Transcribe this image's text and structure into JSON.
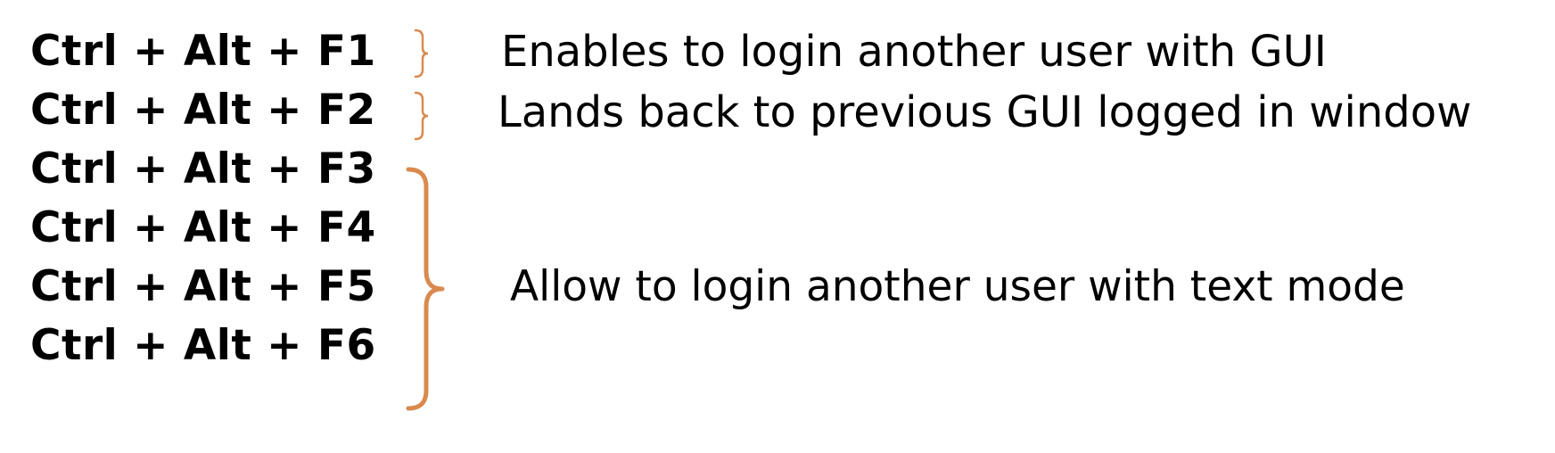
{
  "shortcuts": [
    {
      "keys": "Ctrl + Alt + F1"
    },
    {
      "keys": "Ctrl + Alt + F2"
    },
    {
      "keys": "Ctrl + Alt + F3"
    },
    {
      "keys": "Ctrl + Alt + F4"
    },
    {
      "keys": "Ctrl + Alt + F5"
    },
    {
      "keys": "Ctrl + Alt + F6"
    }
  ],
  "descriptions": {
    "f1": "Enables to login another user with GUI",
    "f2": "Lands back to previous GUI logged in window",
    "f3_f6": "Allow to login another user with text mode"
  },
  "colors": {
    "bracket": "#D98A4E",
    "text": "#000000"
  }
}
